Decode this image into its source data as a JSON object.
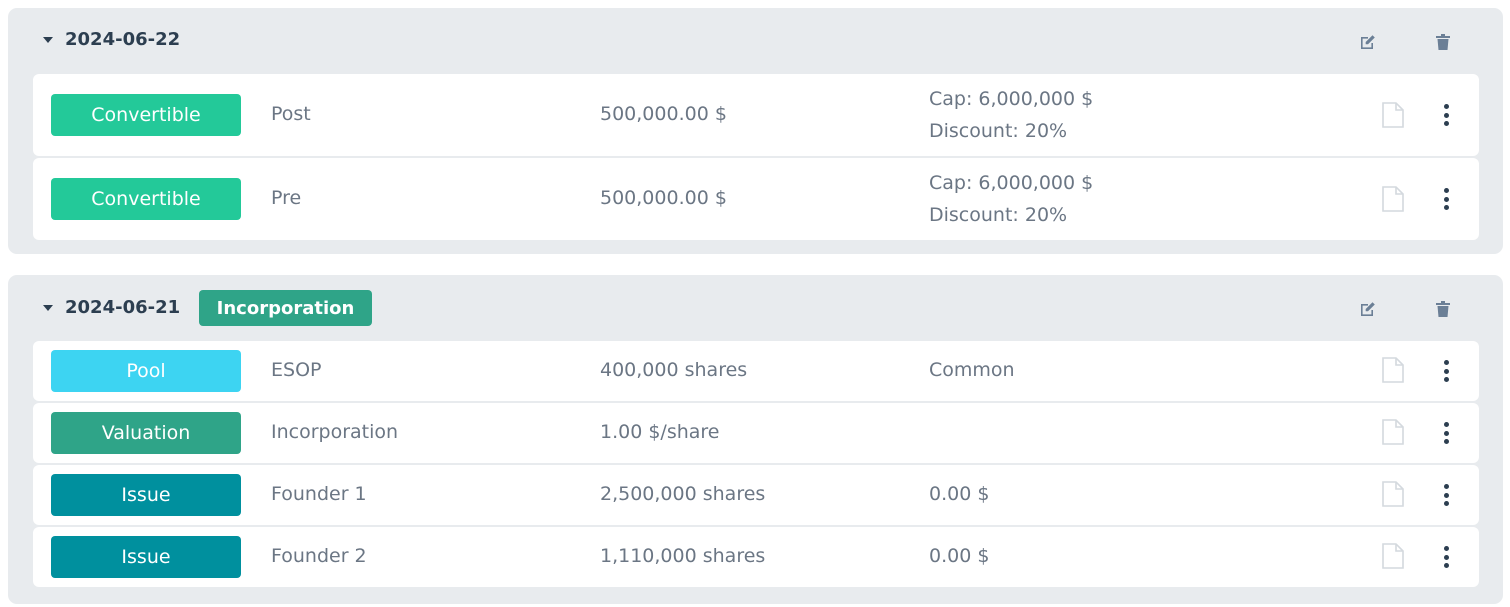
{
  "colors": {
    "convertible": "#23c999",
    "pool": "#3dd4f2",
    "valuation": "#2fa488",
    "issue": "#00909e",
    "incorporation_badge": "#2fa488"
  },
  "groups": [
    {
      "date": "2024-06-22",
      "badge": "",
      "icons": [
        "edit-icon",
        "trash-icon"
      ],
      "rows": [
        {
          "type": "Convertible",
          "type_color": "convertible",
          "name": "Post",
          "amount": "500,000.00 $",
          "detail_1": "Cap: 6,000,000 $",
          "detail_2": "Discount: 20%"
        },
        {
          "type": "Convertible",
          "type_color": "convertible",
          "name": "Pre",
          "amount": "500,000.00 $",
          "detail_1": "Cap: 6,000,000 $",
          "detail_2": "Discount: 20%"
        }
      ]
    },
    {
      "date": "2024-06-21",
      "badge": "Incorporation",
      "icons": [
        "edit-icon",
        "trash-icon"
      ],
      "rows": [
        {
          "type": "Pool",
          "type_color": "pool",
          "name": "ESOP",
          "amount": "400,000 shares",
          "detail_1": "Common"
        },
        {
          "type": "Valuation",
          "type_color": "valuation",
          "name": "Incorporation",
          "amount": "1.00 $/share",
          "detail_1": ""
        },
        {
          "type": "Issue",
          "type_color": "issue",
          "name": "Founder 1",
          "amount": "2,500,000 shares",
          "detail_1": "0.00 $"
        },
        {
          "type": "Issue",
          "type_color": "issue",
          "name": "Founder 2",
          "amount": "1,110,000 shares",
          "detail_1": "0.00 $"
        }
      ]
    }
  ]
}
